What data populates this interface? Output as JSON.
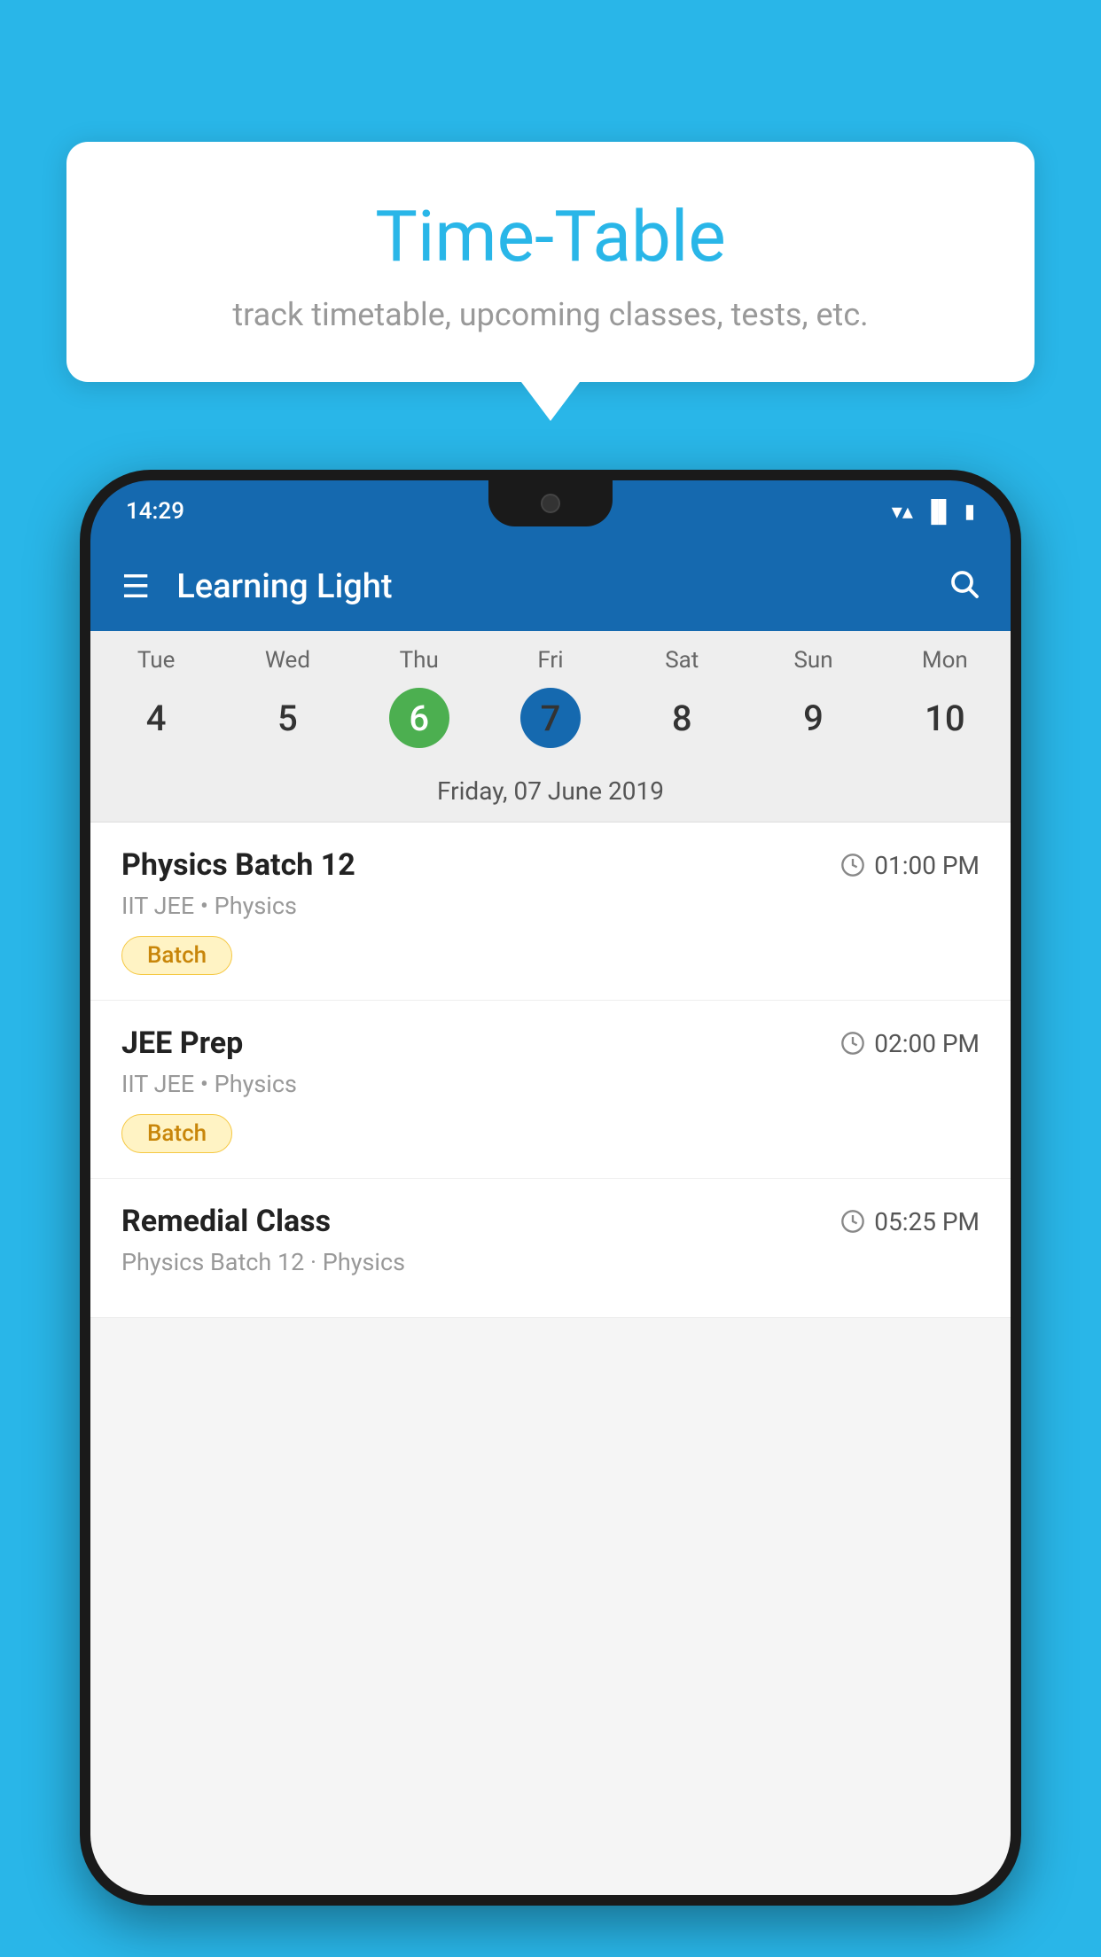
{
  "background_color": "#29B6E8",
  "tooltip": {
    "title": "Time-Table",
    "subtitle": "track timetable, upcoming classes, tests, etc."
  },
  "phone": {
    "status_bar": {
      "time": "14:29"
    },
    "app_header": {
      "title": "Learning Light"
    },
    "calendar": {
      "days": [
        {
          "label": "Tue",
          "number": "4"
        },
        {
          "label": "Wed",
          "number": "5"
        },
        {
          "label": "Thu",
          "number": "6",
          "state": "today"
        },
        {
          "label": "Fri",
          "number": "7",
          "state": "selected"
        },
        {
          "label": "Sat",
          "number": "8"
        },
        {
          "label": "Sun",
          "number": "9"
        },
        {
          "label": "Mon",
          "number": "10"
        }
      ],
      "selected_date_label": "Friday, 07 June 2019"
    },
    "classes": [
      {
        "name": "Physics Batch 12",
        "time": "01:00 PM",
        "subtitle": "IIT JEE • Physics",
        "badge": "Batch"
      },
      {
        "name": "JEE Prep",
        "time": "02:00 PM",
        "subtitle": "IIT JEE • Physics",
        "badge": "Batch"
      },
      {
        "name": "Remedial Class",
        "time": "05:25 PM",
        "subtitle": "Physics Batch 12 · Physics",
        "badge": null
      }
    ]
  },
  "icons": {
    "hamburger": "☰",
    "search": "🔍",
    "clock": "🕐"
  }
}
